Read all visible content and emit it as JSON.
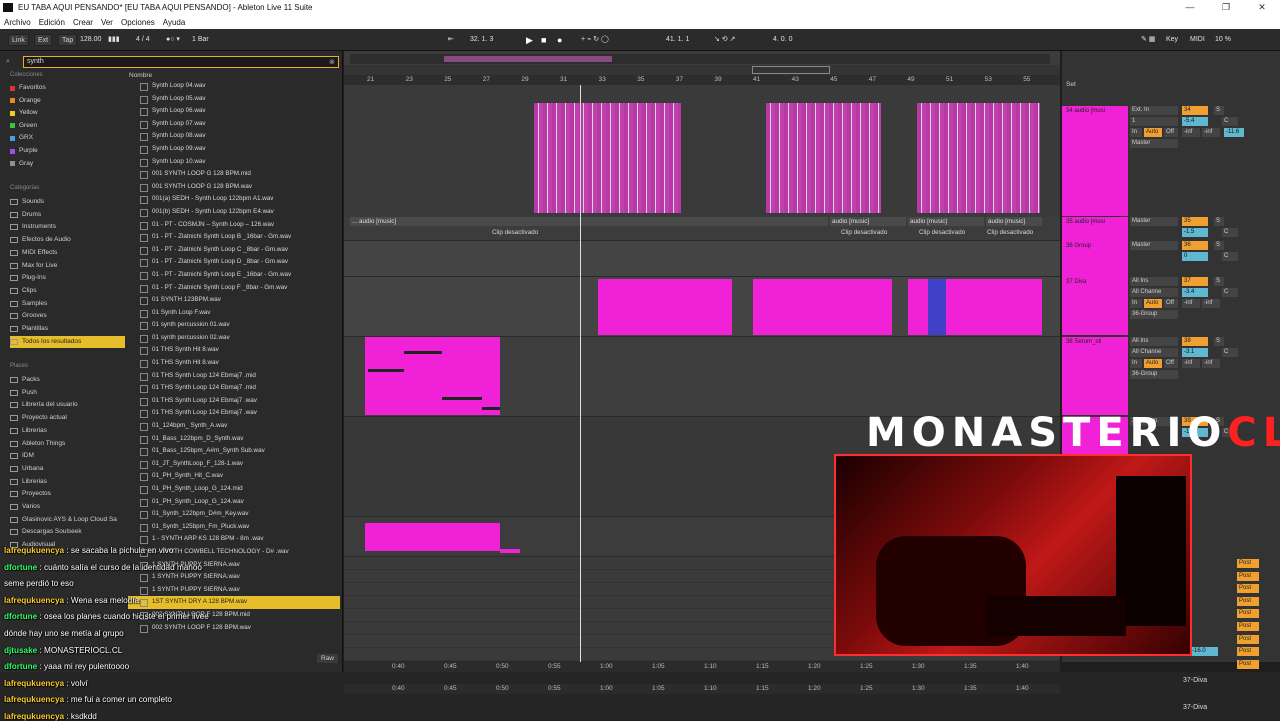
{
  "window": {
    "title": "EU TABA AQUI PENSANDO* [EU TABA AQUI PENSANDO] - Ableton Live 11 Suite"
  },
  "menu": [
    "Archivo",
    "Edición",
    "Crear",
    "Ver",
    "Opciones",
    "Ayuda"
  ],
  "transport": {
    "link": "Link",
    "ext": "Ext",
    "tap": "Tap",
    "tempo": "128.00",
    "signature": "4 / 4",
    "quantize": "1 Bar",
    "position": "32.  1.  3",
    "loop_start": "41.  1.  1",
    "loop_length": "4.  0.  0",
    "key": "Key",
    "midi": "MIDI",
    "cpu": "10 %"
  },
  "browser": {
    "search_value": "synth",
    "collections_label": "Colecciones",
    "collections": [
      {
        "label": "Favoritos",
        "color": "#e03030"
      },
      {
        "label": "Orange",
        "color": "#f08a20"
      },
      {
        "label": "Yellow",
        "color": "#e8d020"
      },
      {
        "label": "Green",
        "color": "#40c040"
      },
      {
        "label": "GRX",
        "color": "#40a0e0"
      },
      {
        "label": "Purple",
        "color": "#a050e0"
      },
      {
        "label": "Gray",
        "color": "#909090"
      }
    ],
    "categories_label": "Categorías",
    "categories": [
      "Sounds",
      "Drums",
      "Instruments",
      "Efectos de Audio",
      "MIDI Effects",
      "Max for Live",
      "Plug-Ins",
      "Clips",
      "Samples",
      "Grooves",
      "Plantillas",
      "Todos los resultados"
    ],
    "places_label": "Places",
    "places": [
      "Packs",
      "Push",
      "Librería del usuario",
      "Proyecto actual",
      "Librerias",
      "Ableton Things",
      "IDM",
      "Urbana",
      "Librerias",
      "Proyectos",
      "Varios",
      "Glasinovic AYS & Loop Cloud Sa",
      "Descargas Soulseek",
      "Audiovisual"
    ],
    "column_header": "Nombre",
    "files": [
      "Synth Loop 04.wav",
      "Synth Loop 05.wav",
      "Synth Loop 06.wav",
      "Synth Loop 07.wav",
      "Synth Loop 08.wav",
      "Synth Loop 09.wav",
      "Synth Loop 10.wav",
      "001 SYNTH LOOP G 128 BPM.mid",
      "001 SYNTH LOOP G 128 BPM.wav",
      "001(a) SEDH - Synth Loop 122bpm A1.wav",
      "001(b) SEDH - Synth Loop 122bpm E4.wav",
      "01 - PT - COSMJN – Synth Loop – 126.wav",
      "01 - PT - Zlatnichi Synth Loop B _16bar - Gm.wav",
      "01 - PT - Zlatnichi Synth Loop C _8bar - Gm.wav",
      "01 - PT - Zlatnichi Synth Loop D _8bar - Gm.wav",
      "01 - PT - Zlatnichi Synth Loop E _16bar - Gm.wav",
      "01 - PT - Zlatnichi Synth Loop F _8bar - Gm.wav",
      "01 SYNTH 123BPM.wav",
      "01 Synth Loop F.wav",
      "01 synth percussion 01.wav",
      "01 synth percussion 02.wav",
      "01 THS Synth Hit 8.wav",
      "01 THS Synth Hit 8.wav",
      "01 THS Synth Loop 124 Ebmaj7 .mid",
      "01 THS Synth Loop 124 Ebmaj7 .mid",
      "01 THS Synth Loop 124 Ebmaj7 .wav",
      "01 THS Synth Loop 124 Ebmaj7 .wav",
      "01_124bpm_ Synth_A.wav",
      "01_Bass_122bpm_D_Synth.wav",
      "01_Bass_125bpm_A#m_Synth Sub.wav",
      "01_JT_SynthLoop_F_128-1.wav",
      "01_PH_Synth_Hit_C.wav",
      "01_PH_Synth_Loop_G_124.mid",
      "01_PH_Synth_Loop_G_124.wav",
      "01_Synth_122bpm_D#m_Key.wav",
      "01_Synth_125bpm_Fm_Pluck.wav",
      "1 - SYNTH ARP KS 128 BPM - 8m .wav",
      "1 - SYNTH COWBELL TECHNOLOGY - D# .wav",
      "1 SYNTH PUPPY SIERNA.wav",
      "1 SYNTH PUPPY SIERNA.wav",
      "1 SYNTH PUPPY SIERNA.wav",
      "1ST SYNTH DRY A 128 BPM.wav",
      "002 SYNTH LOOP F 128 BPM.mid",
      "002 SYNTH LOOP F 128 BPM.wav"
    ],
    "selected_index": 41,
    "raw_label": "Raw"
  },
  "arrangement": {
    "bars": [
      "21",
      "23",
      "25",
      "27",
      "29",
      "31",
      "33",
      "35",
      "37",
      "39",
      "41",
      "43",
      "45",
      "47",
      "49",
      "51",
      "53",
      "55"
    ],
    "set_label": "Set",
    "audio_headers": [
      "... audio [music]",
      "audio [music]",
      "audio [music]",
      "audio [music]"
    ],
    "deactivated": [
      "Clip desactivado",
      "Clip desactivado",
      "Clip desactivado",
      "Clip desactivado"
    ],
    "times": [
      "0:40",
      "0:45",
      "0:50",
      "0:55",
      "1:00",
      "1:05",
      "1:10",
      "1:15",
      "1:20",
      "1:25",
      "1:30",
      "1:35",
      "1:40"
    ]
  },
  "mixer": {
    "tracks": [
      {
        "name": "34 audio [musi",
        "num": "34",
        "vol": "-5.4",
        "pan": "C",
        "route": "Master",
        "input": "Ext. In",
        "ch": "1"
      },
      {
        "name": "35 audio [musi",
        "num": "35",
        "vol": "-1.5",
        "pan": "C",
        "route": "Master"
      },
      {
        "name": "36 Group",
        "num": "36",
        "vol": "0",
        "pan": "C",
        "route": "Master"
      },
      {
        "name": "37 Diva",
        "num": "37",
        "vol": "-3.4",
        "pan": "C",
        "route": "36-Group",
        "input": "All Ins",
        "ch": "All Channe"
      },
      {
        "name": "38 Serum_sti",
        "num": "38",
        "vol": "-3.1",
        "pan": "C",
        "route": "36-Group",
        "input": "All Ins",
        "ch": "All Channe"
      },
      {
        "name": "39",
        "num": "39",
        "vol": "-13.2",
        "pan": "C",
        "route": "36-Group"
      }
    ],
    "monitor_in": "In",
    "monitor_auto": "Auto",
    "monitor_off": "Off",
    "neg_inf": "-inf",
    "neg_val": "-11.6",
    "master_val": "-16.0",
    "post": "Post",
    "s_label": "S"
  },
  "status": {
    "selected_track": "37-Diva"
  },
  "overlay": {
    "brand_main": "MONASTERIO",
    "brand_accent": "CL",
    "chat": [
      {
        "user": "lafrequkuencya",
        "color": "#ffcc33",
        "msg": "se sacaba la pichula en vivo"
      },
      {
        "user": "dfortune",
        "color": "#33ff66",
        "msg": "cuánto salía el curso de la identidad manoo"
      },
      {
        "user": "",
        "color": "#ffffff",
        "msg": "seme perdió to eso"
      },
      {
        "user": "lafrequkuencya",
        "color": "#ffcc33",
        "msg": "Wena esa melodía"
      },
      {
        "user": "dfortune",
        "color": "#33ff66",
        "msg": "osea los planes cuando hiciste el primer livee"
      },
      {
        "user": "",
        "color": "#ffffff",
        "msg": "dónde hay uno se metía al grupo"
      },
      {
        "user": "djtusake",
        "color": "#33ff66",
        "msg": "MONASTERIOCL.CL"
      },
      {
        "user": "dfortune",
        "color": "#33ff66",
        "msg": "yaaa mi rey pulentoooo"
      },
      {
        "user": "lafrequkuencya",
        "color": "#ffcc33",
        "msg": "volví"
      },
      {
        "user": "lafrequkuencya",
        "color": "#ffcc33",
        "msg": "me fui a comer un completo"
      },
      {
        "user": "lafrequkuencya",
        "color": "#ffcc33",
        "msg": "ksdkdd"
      }
    ]
  }
}
